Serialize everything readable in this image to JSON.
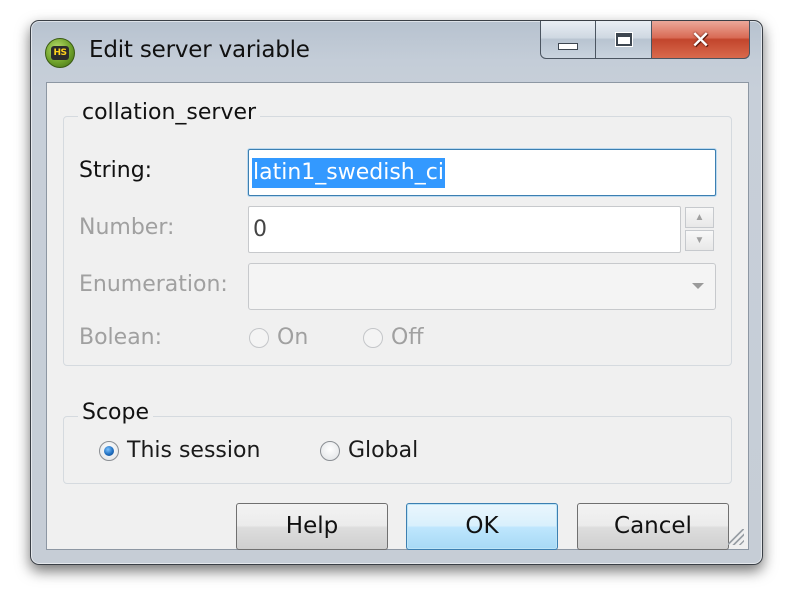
{
  "window": {
    "title": "Edit server variable",
    "app_icon_text": "HS",
    "close_glyph": "✕"
  },
  "variable_group": {
    "caption": "collation_server",
    "string_label": "String:",
    "string_value": "latin1_swedish_ci",
    "number_label": "Number:",
    "number_value": "0",
    "enumeration_label": "Enumeration:",
    "enumeration_value": "",
    "boolean_label": "Bolean:",
    "boolean_on": "On",
    "boolean_off": "Off"
  },
  "scope_group": {
    "caption": "Scope",
    "this_session": "This session",
    "global": "Global",
    "selected": "This session"
  },
  "buttons": {
    "help": "Help",
    "ok": "OK",
    "cancel": "Cancel"
  },
  "icons": {
    "spin_up": "▲",
    "spin_down": "▼"
  }
}
